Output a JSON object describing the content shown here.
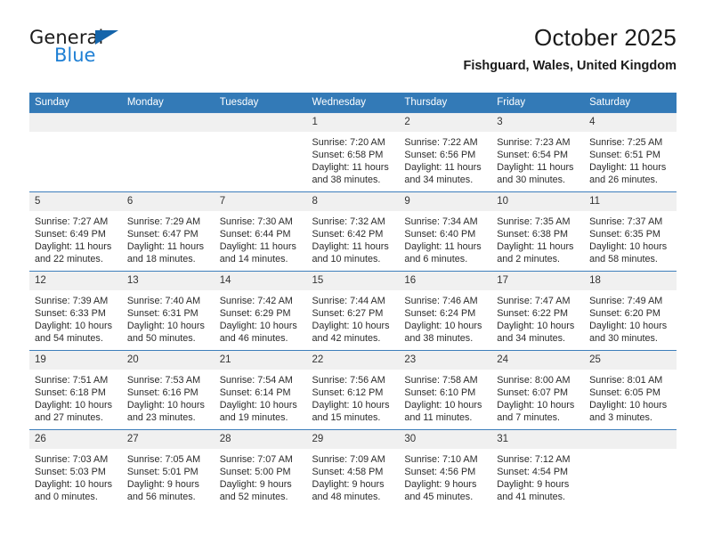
{
  "logo": {
    "primary_text": "General",
    "secondary_text": "Blue",
    "primary_color": "#1b1b1b",
    "secondary_color": "#1e7fd4",
    "triangle_color": "#1464aa"
  },
  "header": {
    "title": "October 2025",
    "subtitle": "Fishguard, Wales, United Kingdom"
  },
  "theme": {
    "header_bg": "#337ab7",
    "header_text": "#ffffff",
    "daynum_bg": "#f0f0f0",
    "row_divider": "#3d7ebb",
    "body_text": "#2b2b2b"
  },
  "calendar": {
    "weekday_headers": [
      "Sunday",
      "Monday",
      "Tuesday",
      "Wednesday",
      "Thursday",
      "Friday",
      "Saturday"
    ],
    "weeks": [
      [
        {
          "day": "",
          "empty": true,
          "sunrise": "",
          "sunset": "",
          "daylight_line1": "",
          "daylight_line2": ""
        },
        {
          "day": "",
          "empty": true,
          "sunrise": "",
          "sunset": "",
          "daylight_line1": "",
          "daylight_line2": ""
        },
        {
          "day": "",
          "empty": true,
          "sunrise": "",
          "sunset": "",
          "daylight_line1": "",
          "daylight_line2": ""
        },
        {
          "day": "1",
          "empty": false,
          "sunrise": "Sunrise: 7:20 AM",
          "sunset": "Sunset: 6:58 PM",
          "daylight_line1": "Daylight: 11 hours",
          "daylight_line2": "and 38 minutes."
        },
        {
          "day": "2",
          "empty": false,
          "sunrise": "Sunrise: 7:22 AM",
          "sunset": "Sunset: 6:56 PM",
          "daylight_line1": "Daylight: 11 hours",
          "daylight_line2": "and 34 minutes."
        },
        {
          "day": "3",
          "empty": false,
          "sunrise": "Sunrise: 7:23 AM",
          "sunset": "Sunset: 6:54 PM",
          "daylight_line1": "Daylight: 11 hours",
          "daylight_line2": "and 30 minutes."
        },
        {
          "day": "4",
          "empty": false,
          "sunrise": "Sunrise: 7:25 AM",
          "sunset": "Sunset: 6:51 PM",
          "daylight_line1": "Daylight: 11 hours",
          "daylight_line2": "and 26 minutes."
        }
      ],
      [
        {
          "day": "5",
          "empty": false,
          "sunrise": "Sunrise: 7:27 AM",
          "sunset": "Sunset: 6:49 PM",
          "daylight_line1": "Daylight: 11 hours",
          "daylight_line2": "and 22 minutes."
        },
        {
          "day": "6",
          "empty": false,
          "sunrise": "Sunrise: 7:29 AM",
          "sunset": "Sunset: 6:47 PM",
          "daylight_line1": "Daylight: 11 hours",
          "daylight_line2": "and 18 minutes."
        },
        {
          "day": "7",
          "empty": false,
          "sunrise": "Sunrise: 7:30 AM",
          "sunset": "Sunset: 6:44 PM",
          "daylight_line1": "Daylight: 11 hours",
          "daylight_line2": "and 14 minutes."
        },
        {
          "day": "8",
          "empty": false,
          "sunrise": "Sunrise: 7:32 AM",
          "sunset": "Sunset: 6:42 PM",
          "daylight_line1": "Daylight: 11 hours",
          "daylight_line2": "and 10 minutes."
        },
        {
          "day": "9",
          "empty": false,
          "sunrise": "Sunrise: 7:34 AM",
          "sunset": "Sunset: 6:40 PM",
          "daylight_line1": "Daylight: 11 hours",
          "daylight_line2": "and 6 minutes."
        },
        {
          "day": "10",
          "empty": false,
          "sunrise": "Sunrise: 7:35 AM",
          "sunset": "Sunset: 6:38 PM",
          "daylight_line1": "Daylight: 11 hours",
          "daylight_line2": "and 2 minutes."
        },
        {
          "day": "11",
          "empty": false,
          "sunrise": "Sunrise: 7:37 AM",
          "sunset": "Sunset: 6:35 PM",
          "daylight_line1": "Daylight: 10 hours",
          "daylight_line2": "and 58 minutes."
        }
      ],
      [
        {
          "day": "12",
          "empty": false,
          "sunrise": "Sunrise: 7:39 AM",
          "sunset": "Sunset: 6:33 PM",
          "daylight_line1": "Daylight: 10 hours",
          "daylight_line2": "and 54 minutes."
        },
        {
          "day": "13",
          "empty": false,
          "sunrise": "Sunrise: 7:40 AM",
          "sunset": "Sunset: 6:31 PM",
          "daylight_line1": "Daylight: 10 hours",
          "daylight_line2": "and 50 minutes."
        },
        {
          "day": "14",
          "empty": false,
          "sunrise": "Sunrise: 7:42 AM",
          "sunset": "Sunset: 6:29 PM",
          "daylight_line1": "Daylight: 10 hours",
          "daylight_line2": "and 46 minutes."
        },
        {
          "day": "15",
          "empty": false,
          "sunrise": "Sunrise: 7:44 AM",
          "sunset": "Sunset: 6:27 PM",
          "daylight_line1": "Daylight: 10 hours",
          "daylight_line2": "and 42 minutes."
        },
        {
          "day": "16",
          "empty": false,
          "sunrise": "Sunrise: 7:46 AM",
          "sunset": "Sunset: 6:24 PM",
          "daylight_line1": "Daylight: 10 hours",
          "daylight_line2": "and 38 minutes."
        },
        {
          "day": "17",
          "empty": false,
          "sunrise": "Sunrise: 7:47 AM",
          "sunset": "Sunset: 6:22 PM",
          "daylight_line1": "Daylight: 10 hours",
          "daylight_line2": "and 34 minutes."
        },
        {
          "day": "18",
          "empty": false,
          "sunrise": "Sunrise: 7:49 AM",
          "sunset": "Sunset: 6:20 PM",
          "daylight_line1": "Daylight: 10 hours",
          "daylight_line2": "and 30 minutes."
        }
      ],
      [
        {
          "day": "19",
          "empty": false,
          "sunrise": "Sunrise: 7:51 AM",
          "sunset": "Sunset: 6:18 PM",
          "daylight_line1": "Daylight: 10 hours",
          "daylight_line2": "and 27 minutes."
        },
        {
          "day": "20",
          "empty": false,
          "sunrise": "Sunrise: 7:53 AM",
          "sunset": "Sunset: 6:16 PM",
          "daylight_line1": "Daylight: 10 hours",
          "daylight_line2": "and 23 minutes."
        },
        {
          "day": "21",
          "empty": false,
          "sunrise": "Sunrise: 7:54 AM",
          "sunset": "Sunset: 6:14 PM",
          "daylight_line1": "Daylight: 10 hours",
          "daylight_line2": "and 19 minutes."
        },
        {
          "day": "22",
          "empty": false,
          "sunrise": "Sunrise: 7:56 AM",
          "sunset": "Sunset: 6:12 PM",
          "daylight_line1": "Daylight: 10 hours",
          "daylight_line2": "and 15 minutes."
        },
        {
          "day": "23",
          "empty": false,
          "sunrise": "Sunrise: 7:58 AM",
          "sunset": "Sunset: 6:10 PM",
          "daylight_line1": "Daylight: 10 hours",
          "daylight_line2": "and 11 minutes."
        },
        {
          "day": "24",
          "empty": false,
          "sunrise": "Sunrise: 8:00 AM",
          "sunset": "Sunset: 6:07 PM",
          "daylight_line1": "Daylight: 10 hours",
          "daylight_line2": "and 7 minutes."
        },
        {
          "day": "25",
          "empty": false,
          "sunrise": "Sunrise: 8:01 AM",
          "sunset": "Sunset: 6:05 PM",
          "daylight_line1": "Daylight: 10 hours",
          "daylight_line2": "and 3 minutes."
        }
      ],
      [
        {
          "day": "26",
          "empty": false,
          "sunrise": "Sunrise: 7:03 AM",
          "sunset": "Sunset: 5:03 PM",
          "daylight_line1": "Daylight: 10 hours",
          "daylight_line2": "and 0 minutes."
        },
        {
          "day": "27",
          "empty": false,
          "sunrise": "Sunrise: 7:05 AM",
          "sunset": "Sunset: 5:01 PM",
          "daylight_line1": "Daylight: 9 hours",
          "daylight_line2": "and 56 minutes."
        },
        {
          "day": "28",
          "empty": false,
          "sunrise": "Sunrise: 7:07 AM",
          "sunset": "Sunset: 5:00 PM",
          "daylight_line1": "Daylight: 9 hours",
          "daylight_line2": "and 52 minutes."
        },
        {
          "day": "29",
          "empty": false,
          "sunrise": "Sunrise: 7:09 AM",
          "sunset": "Sunset: 4:58 PM",
          "daylight_line1": "Daylight: 9 hours",
          "daylight_line2": "and 48 minutes."
        },
        {
          "day": "30",
          "empty": false,
          "sunrise": "Sunrise: 7:10 AM",
          "sunset": "Sunset: 4:56 PM",
          "daylight_line1": "Daylight: 9 hours",
          "daylight_line2": "and 45 minutes."
        },
        {
          "day": "31",
          "empty": false,
          "sunrise": "Sunrise: 7:12 AM",
          "sunset": "Sunset: 4:54 PM",
          "daylight_line1": "Daylight: 9 hours",
          "daylight_line2": "and 41 minutes."
        },
        {
          "day": "",
          "empty": true,
          "sunrise": "",
          "sunset": "",
          "daylight_line1": "",
          "daylight_line2": ""
        }
      ]
    ]
  }
}
